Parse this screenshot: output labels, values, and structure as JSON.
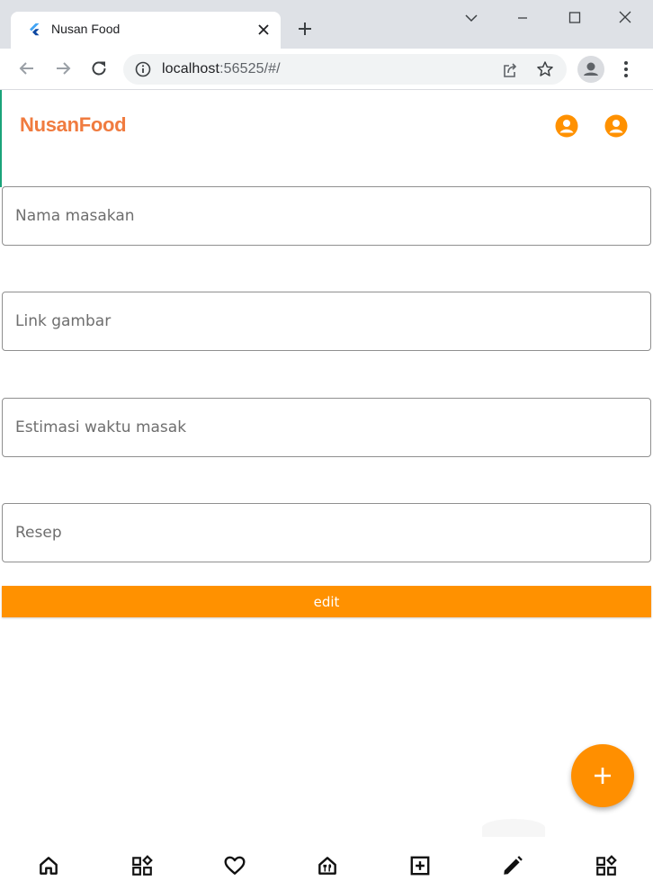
{
  "browser": {
    "tab_title": "Nusan Food",
    "url_host": "localhost",
    "url_rest": ":56525/#/"
  },
  "app": {
    "brand": "NusanFood",
    "accent_color": "#ff9100",
    "brand_color": "#f07b3f"
  },
  "form": {
    "fields": [
      {
        "placeholder": "Nama masakan",
        "value": ""
      },
      {
        "placeholder": "Link gambar",
        "value": ""
      },
      {
        "placeholder": "Estimasi waktu masak",
        "value": ""
      },
      {
        "placeholder": "Resep",
        "value": ""
      }
    ],
    "submit_label": "edit"
  },
  "bottom_nav": {
    "items": [
      "home-icon",
      "category-icon",
      "favorite-icon",
      "restaurant-icon",
      "add-box-icon",
      "edit-icon",
      "category-icon"
    ]
  }
}
